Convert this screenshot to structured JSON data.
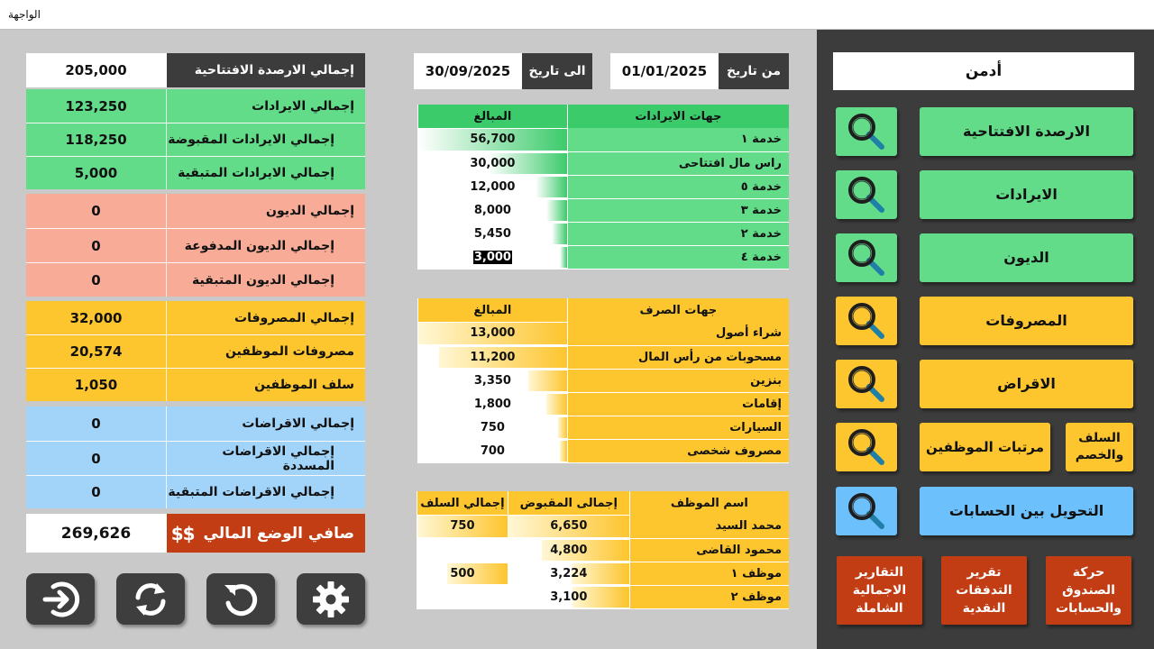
{
  "window": {
    "title": "الواجهة"
  },
  "summary": {
    "opening": {
      "label": "إجمالي الارصدة الافتتاحية",
      "value": "205,000"
    },
    "revenue_total": {
      "label": "إجمالي الايرادات",
      "value": "123,250"
    },
    "revenue_received": {
      "label": "إجمالي الايرادات المقبوضة",
      "value": "118,250"
    },
    "revenue_remaining": {
      "label": "إجمالي الايرادات المتبقية",
      "value": "5,000"
    },
    "debt_total": {
      "label": "إجمالي الديون",
      "value": "0"
    },
    "debt_paid": {
      "label": "إجمالي الديون المدفوعة",
      "value": "0"
    },
    "debt_remaining": {
      "label": "إجمالي الديون المتبقية",
      "value": "0"
    },
    "expenses_total": {
      "label": "إجمالي المصروفات",
      "value": "32,000"
    },
    "staff_expenses": {
      "label": "مصروفات الموظفين",
      "value": "20,574"
    },
    "staff_advances": {
      "label": "سلف الموظفين",
      "value": "1,050"
    },
    "loans_total": {
      "label": "إجمالي الاقراضات",
      "value": "0"
    },
    "loans_repaid": {
      "label": "إجمالي الاقراضات المسددة",
      "value": "0"
    },
    "loans_remaining": {
      "label": "إجمالي الاقراضات المتبقية",
      "value": "0"
    },
    "net": {
      "label": "صافي الوضع المالي",
      "value": "269,626",
      "icon": "dollar-icon"
    }
  },
  "controls": [
    "exit-icon",
    "sync-icon",
    "refresh-icon",
    "settings-icon"
  ],
  "dates": {
    "from_label": "من تاريخ",
    "from_value": "01/01/2025",
    "to_label": "الى تاريخ",
    "to_value": "30/09/2025"
  },
  "revenue_table": {
    "headers": [
      "جهات الايرادات",
      "المبالغ"
    ],
    "rows": [
      {
        "name": "خدمة ١",
        "amount": "56,700",
        "fill": 1.0
      },
      {
        "name": "راس مال افتتاحى",
        "amount": "30,000",
        "fill": 0.53
      },
      {
        "name": "خدمة ٥",
        "amount": "12,000",
        "fill": 0.21
      },
      {
        "name": "خدمة ٣",
        "amount": "8,000",
        "fill": 0.14
      },
      {
        "name": "خدمة ٢",
        "amount": "5,450",
        "fill": 0.1
      },
      {
        "name": "خدمة ٤",
        "amount": "3,000",
        "fill": 0.05
      }
    ]
  },
  "expense_table": {
    "headers": [
      "جهات الصرف",
      "المبالغ"
    ],
    "rows": [
      {
        "name": "شراء أصول",
        "amount": "13,000",
        "fill": 1.0
      },
      {
        "name": "مسحوبات من رأس المال",
        "amount": "11,200",
        "fill": 0.86
      },
      {
        "name": "بنزين",
        "amount": "3,350",
        "fill": 0.26
      },
      {
        "name": "إقامات",
        "amount": "1,800",
        "fill": 0.14
      },
      {
        "name": "السيارات",
        "amount": "750",
        "fill": 0.06
      },
      {
        "name": "مصروف شخصى",
        "amount": "700",
        "fill": 0.05
      }
    ]
  },
  "employees_table": {
    "headers": [
      "اسم الموظف",
      "إجمالى المقبوض",
      "إجمالي السلف"
    ],
    "rows": [
      {
        "name": "محمد السيد",
        "received": "6,650",
        "received_fill": 1.0,
        "advance": "750",
        "advance_fill": 1.0
      },
      {
        "name": "محمود القاضى",
        "received": "4,800",
        "received_fill": 0.72,
        "advance": "",
        "advance_fill": 0
      },
      {
        "name": "موظف ١",
        "received": "3,224",
        "received_fill": 0.48,
        "advance": "500",
        "advance_fill": 0.67
      },
      {
        "name": "موظف ٢",
        "received": "3,100",
        "received_fill": 0.47,
        "advance": "",
        "advance_fill": 0
      }
    ]
  },
  "sidebar": {
    "user": "أدمن",
    "buttons": {
      "opening": "الارصدة الافتتاحية",
      "revenues": "الايرادات",
      "debts": "الديون",
      "expenses": "المصروفات",
      "loans": "الاقراض",
      "salaries": "مرتبات الموظفين",
      "advances": "السلف والخصم",
      "transfer": "التحويل بين الحسابات"
    },
    "reports": {
      "cash_movement": "حركة الصندوق والحسابات",
      "cash_flow": "تقرير التدفقات النقدية",
      "overall": "التقارير الاجمالية الشاملة"
    },
    "colors": {
      "green": "#63dc89",
      "yellow": "#fdc52e",
      "blue": "#6cc0fb",
      "red": "#c23d14"
    }
  }
}
